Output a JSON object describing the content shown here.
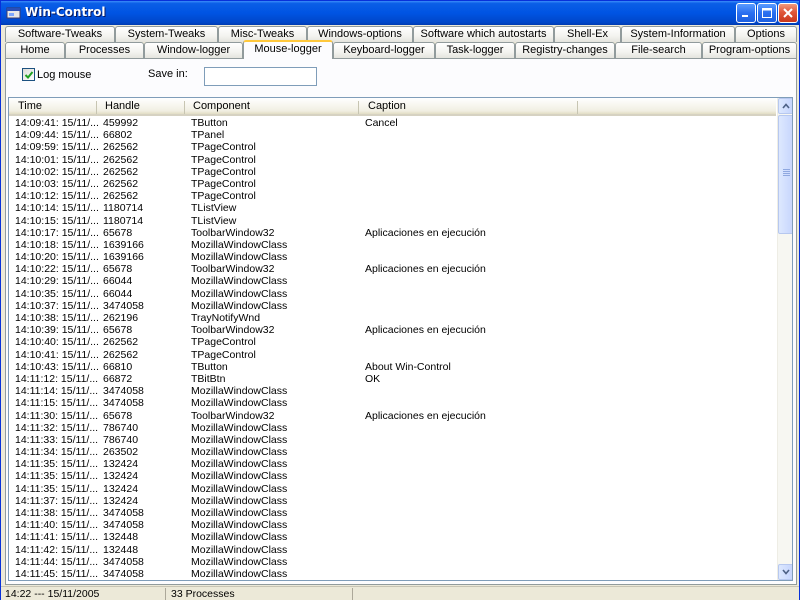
{
  "window": {
    "title": "Win-Control"
  },
  "tabs": {
    "row1": [
      "Software-Tweaks",
      "System-Tweaks",
      "Misc-Tweaks",
      "Windows-options",
      "Software which autostarts",
      "Shell-Ex",
      "System-Information",
      "Options"
    ],
    "row2": [
      "Home",
      "Processes",
      "Window-logger",
      "Mouse-logger",
      "Keyboard-logger",
      "Task-logger",
      "Registry-changes",
      "File-search",
      "Program-options"
    ],
    "active": "Mouse-logger"
  },
  "options": {
    "log_mouse_label": "Log mouse",
    "log_mouse_checked": true,
    "save_in_label": "Save in:",
    "save_in_value": ""
  },
  "columns": [
    "Time",
    "Handle",
    "Component",
    "Caption"
  ],
  "rows": [
    [
      "14:09:41: 15/11/...",
      "459992",
      "TButton",
      "Cancel"
    ],
    [
      "14:09:44: 15/11/...",
      "66802",
      "TPanel",
      ""
    ],
    [
      "14:09:59: 15/11/...",
      "262562",
      "TPageControl",
      ""
    ],
    [
      "14:10:01: 15/11/...",
      "262562",
      "TPageControl",
      ""
    ],
    [
      "14:10:02: 15/11/...",
      "262562",
      "TPageControl",
      ""
    ],
    [
      "14:10:03: 15/11/...",
      "262562",
      "TPageControl",
      ""
    ],
    [
      "14:10:12: 15/11/...",
      "262562",
      "TPageControl",
      ""
    ],
    [
      "14:10:14: 15/11/...",
      "1180714",
      "TListView",
      ""
    ],
    [
      "14:10:15: 15/11/...",
      "1180714",
      "TListView",
      ""
    ],
    [
      "14:10:17: 15/11/...",
      "65678",
      "ToolbarWindow32",
      "Aplicaciones en ejecución"
    ],
    [
      "14:10:18: 15/11/...",
      "1639166",
      "MozillaWindowClass",
      ""
    ],
    [
      "14:10:20: 15/11/...",
      "1639166",
      "MozillaWindowClass",
      ""
    ],
    [
      "14:10:22: 15/11/...",
      "65678",
      "ToolbarWindow32",
      "Aplicaciones en ejecución"
    ],
    [
      "14:10:29: 15/11/...",
      "66044",
      "MozillaWindowClass",
      ""
    ],
    [
      "14:10:35: 15/11/...",
      "66044",
      "MozillaWindowClass",
      ""
    ],
    [
      "14:10:37: 15/11/...",
      "3474058",
      "MozillaWindowClass",
      ""
    ],
    [
      "14:10:38: 15/11/...",
      "262196",
      "TrayNotifyWnd",
      ""
    ],
    [
      "14:10:39: 15/11/...",
      "65678",
      "ToolbarWindow32",
      "Aplicaciones en ejecución"
    ],
    [
      "14:10:40: 15/11/...",
      "262562",
      "TPageControl",
      ""
    ],
    [
      "14:10:41: 15/11/...",
      "262562",
      "TPageControl",
      ""
    ],
    [
      "14:10:43: 15/11/...",
      "66810",
      "TButton",
      "About Win-Control"
    ],
    [
      "14:11:12: 15/11/...",
      "66872",
      "TBitBtn",
      "OK"
    ],
    [
      "14:11:14: 15/11/...",
      "3474058",
      "MozillaWindowClass",
      ""
    ],
    [
      "14:11:15: 15/11/...",
      "3474058",
      "MozillaWindowClass",
      ""
    ],
    [
      "14:11:30: 15/11/...",
      "65678",
      "ToolbarWindow32",
      "Aplicaciones en ejecución"
    ],
    [
      "14:11:32: 15/11/...",
      "786740",
      "MozillaWindowClass",
      ""
    ],
    [
      "14:11:33: 15/11/...",
      "786740",
      "MozillaWindowClass",
      ""
    ],
    [
      "14:11:34: 15/11/...",
      "263502",
      "MozillaWindowClass",
      ""
    ],
    [
      "14:11:35: 15/11/...",
      "132424",
      "MozillaWindowClass",
      ""
    ],
    [
      "14:11:35: 15/11/...",
      "132424",
      "MozillaWindowClass",
      ""
    ],
    [
      "14:11:35: 15/11/...",
      "132424",
      "MozillaWindowClass",
      ""
    ],
    [
      "14:11:37: 15/11/...",
      "132424",
      "MozillaWindowClass",
      ""
    ],
    [
      "14:11:38: 15/11/...",
      "3474058",
      "MozillaWindowClass",
      ""
    ],
    [
      "14:11:40: 15/11/...",
      "3474058",
      "MozillaWindowClass",
      ""
    ],
    [
      "14:11:41: 15/11/...",
      "132448",
      "MozillaWindowClass",
      ""
    ],
    [
      "14:11:42: 15/11/...",
      "132448",
      "MozillaWindowClass",
      ""
    ],
    [
      "14:11:44: 15/11/...",
      "3474058",
      "MozillaWindowClass",
      ""
    ],
    [
      "14:11:45: 15/11/...",
      "3474058",
      "MozillaWindowClass",
      ""
    ]
  ],
  "status": {
    "datetime": "14:22 --- 15/11/2005",
    "processes": "33 Processes",
    "message": ""
  },
  "colors": {
    "titlebar": "#0054e3",
    "active_tab_accent": "#ffc83c",
    "window_bg": "#ece9d8"
  },
  "icons": {
    "app": "app-icon",
    "minimize": "minimize-icon",
    "maximize": "maximize-icon",
    "close": "close-icon",
    "check": "checkmark-icon",
    "scroll_up": "chevron-up-icon",
    "scroll_down": "chevron-down-icon"
  }
}
